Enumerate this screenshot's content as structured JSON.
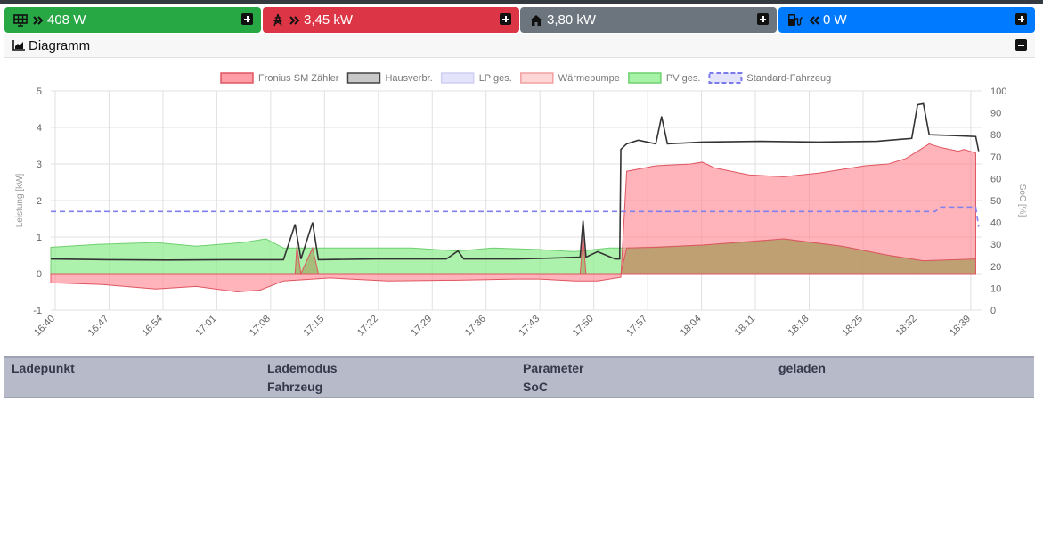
{
  "tiles": [
    {
      "icon": "solar-panel-icon",
      "arrow": "double-chevron-right-icon",
      "value": "408 W",
      "color": "#28a745",
      "text_color": "#fff"
    },
    {
      "icon": "power-grid-icon",
      "arrow": "double-chevron-right-icon",
      "value": "3,45 kW",
      "color": "#dc3545",
      "text_color": "#fff"
    },
    {
      "icon": "house-icon",
      "arrow": "",
      "value": "3,80 kW",
      "color": "#6c757d",
      "text_color": "#fff"
    },
    {
      "icon": "charging-station-icon",
      "arrow": "double-chevron-left-icon",
      "value": "0 W",
      "color": "#007bff",
      "text_color": "#fff"
    }
  ],
  "panel": {
    "title": "Diagramm",
    "icon": "area-chart-icon"
  },
  "chart_data": {
    "type": "area",
    "x_ticks": [
      "16:40",
      "16:47",
      "16:54",
      "17:01",
      "17:08",
      "17:15",
      "17:22",
      "17:29",
      "17:36",
      "17:43",
      "17:50",
      "17:57",
      "18:04",
      "18:11",
      "18:18",
      "18:25",
      "18:32",
      "18:39"
    ],
    "ylabel": "Leistung [kW]",
    "ylim": [
      -1,
      5
    ],
    "y_ticks": [
      "-1",
      "0",
      "1",
      "2",
      "3",
      "4",
      "5"
    ],
    "y2label": "SoC [%]",
    "y2lim": [
      0,
      100
    ],
    "y2_ticks": [
      "0",
      "10",
      "20",
      "30",
      "40",
      "50",
      "60",
      "70",
      "80",
      "90",
      "100"
    ],
    "grid": true,
    "legend_position": "top",
    "legend": [
      {
        "name": "Fronius SM Zähler",
        "fill": "#ff9da7",
        "stroke": "#e05561",
        "dashed": false
      },
      {
        "name": "Hausverbr.",
        "fill": "#c8c8c8",
        "stroke": "#444444",
        "dashed": false
      },
      {
        "name": "LP ges.",
        "fill": "#e3e3fb",
        "stroke": "#cfcff3",
        "dashed": false
      },
      {
        "name": "Wärmepumpe",
        "fill": "#ffd6d6",
        "stroke": "#f1a0a0",
        "dashed": false
      },
      {
        "name": "PV ges.",
        "fill": "#a6f2a6",
        "stroke": "#6fcf6f",
        "dashed": false
      },
      {
        "name": "Standard-Fahrzeug",
        "fill": "#e3e3fb",
        "stroke": "#7a7ae8",
        "dashed": true
      }
    ],
    "series": [
      {
        "name": "Fronius SM Zähler",
        "unit": "kW",
        "points": [
          [
            0,
            -0.25
          ],
          [
            9,
            -0.3
          ],
          [
            18,
            -0.42
          ],
          [
            25,
            -0.35
          ],
          [
            32,
            -0.5
          ],
          [
            36,
            -0.45
          ],
          [
            40,
            -0.2
          ],
          [
            48,
            -0.12
          ],
          [
            58,
            -0.2
          ],
          [
            70,
            -0.18
          ],
          [
            80,
            -0.15
          ],
          [
            84,
            -0.15
          ],
          [
            90,
            -0.2
          ],
          [
            94,
            -0.2
          ],
          [
            98,
            -0.1
          ],
          [
            99,
            2.8
          ],
          [
            104,
            2.95
          ],
          [
            110,
            3.0
          ],
          [
            112,
            3.05
          ],
          [
            114,
            2.9
          ],
          [
            117,
            2.8
          ],
          [
            120,
            2.7
          ],
          [
            126,
            2.65
          ],
          [
            132,
            2.75
          ],
          [
            136,
            2.85
          ],
          [
            140,
            2.95
          ],
          [
            144,
            3.0
          ],
          [
            147,
            3.15
          ],
          [
            149,
            3.35
          ],
          [
            151,
            3.55
          ],
          [
            153,
            3.45
          ],
          [
            156,
            3.35
          ],
          [
            157,
            3.4
          ],
          [
            159,
            3.3
          ]
        ]
      },
      {
        "name": "Hausverbr.",
        "unit": "kW",
        "points": [
          [
            0,
            0.4
          ],
          [
            10,
            0.38
          ],
          [
            20,
            0.37
          ],
          [
            30,
            0.38
          ],
          [
            40,
            0.38
          ],
          [
            42,
            1.35
          ],
          [
            43,
            0.4
          ],
          [
            45,
            1.4
          ],
          [
            46,
            0.38
          ],
          [
            56,
            0.4
          ],
          [
            68,
            0.4
          ],
          [
            70,
            0.62
          ],
          [
            71,
            0.4
          ],
          [
            80,
            0.4
          ],
          [
            85,
            0.42
          ],
          [
            91,
            0.45
          ],
          [
            91.5,
            1.45
          ],
          [
            92,
            0.45
          ],
          [
            94,
            0.6
          ],
          [
            97,
            0.4
          ],
          [
            97.8,
            0.4
          ],
          [
            98,
            3.4
          ],
          [
            99,
            3.55
          ],
          [
            101,
            3.65
          ],
          [
            104,
            3.55
          ],
          [
            105,
            4.3
          ],
          [
            106,
            3.55
          ],
          [
            112,
            3.6
          ],
          [
            122,
            3.62
          ],
          [
            132,
            3.6
          ],
          [
            142,
            3.62
          ],
          [
            148,
            3.7
          ],
          [
            149,
            4.62
          ],
          [
            150,
            4.65
          ],
          [
            151,
            3.8
          ],
          [
            155,
            3.78
          ],
          [
            159,
            3.75
          ],
          [
            159.5,
            3.35
          ]
        ]
      },
      {
        "name": "Wärmepumpe",
        "unit": "kW",
        "points": [
          [
            0,
            0
          ],
          [
            42,
            0
          ],
          [
            42.3,
            0.75
          ],
          [
            43,
            0
          ],
          [
            45,
            0.7
          ],
          [
            46,
            0
          ],
          [
            91,
            0
          ],
          [
            91.5,
            1.0
          ],
          [
            92,
            0
          ],
          [
            98,
            0
          ],
          [
            99,
            0.7
          ],
          [
            104,
            0.72
          ],
          [
            112,
            0.78
          ],
          [
            126,
            0.95
          ],
          [
            136,
            0.75
          ],
          [
            144,
            0.5
          ],
          [
            150,
            0.35
          ],
          [
            159,
            0.4
          ]
        ]
      },
      {
        "name": "PV ges.",
        "unit": "kW",
        "points": [
          [
            0,
            0.72
          ],
          [
            8,
            0.8
          ],
          [
            18,
            0.85
          ],
          [
            25,
            0.75
          ],
          [
            33,
            0.85
          ],
          [
            37,
            0.95
          ],
          [
            40,
            0.7
          ],
          [
            48,
            0.7
          ],
          [
            58,
            0.7
          ],
          [
            62,
            0.7
          ],
          [
            70,
            0.62
          ],
          [
            76,
            0.7
          ],
          [
            84,
            0.66
          ],
          [
            90,
            0.6
          ],
          [
            96,
            0.7
          ],
          [
            98,
            0.7
          ],
          [
            99,
            0.7
          ],
          [
            112,
            0.78
          ],
          [
            120,
            0.85
          ],
          [
            126,
            0.95
          ],
          [
            136,
            0.75
          ],
          [
            144,
            0.5
          ],
          [
            150,
            0.35
          ],
          [
            159,
            0.4
          ]
        ]
      },
      {
        "name": "Standard-Fahrzeug",
        "unit": "%",
        "points": [
          [
            0,
            45
          ],
          [
            152,
            45
          ],
          [
            153,
            47
          ],
          [
            159,
            47
          ],
          [
            159.5,
            38
          ]
        ]
      }
    ]
  },
  "ladepunkt_table": {
    "headers_row1": [
      "Ladepunkt",
      "Lademodus",
      "Parameter",
      "geladen"
    ],
    "headers_row2": [
      "",
      "Fahrzeug",
      "SoC",
      ""
    ]
  }
}
